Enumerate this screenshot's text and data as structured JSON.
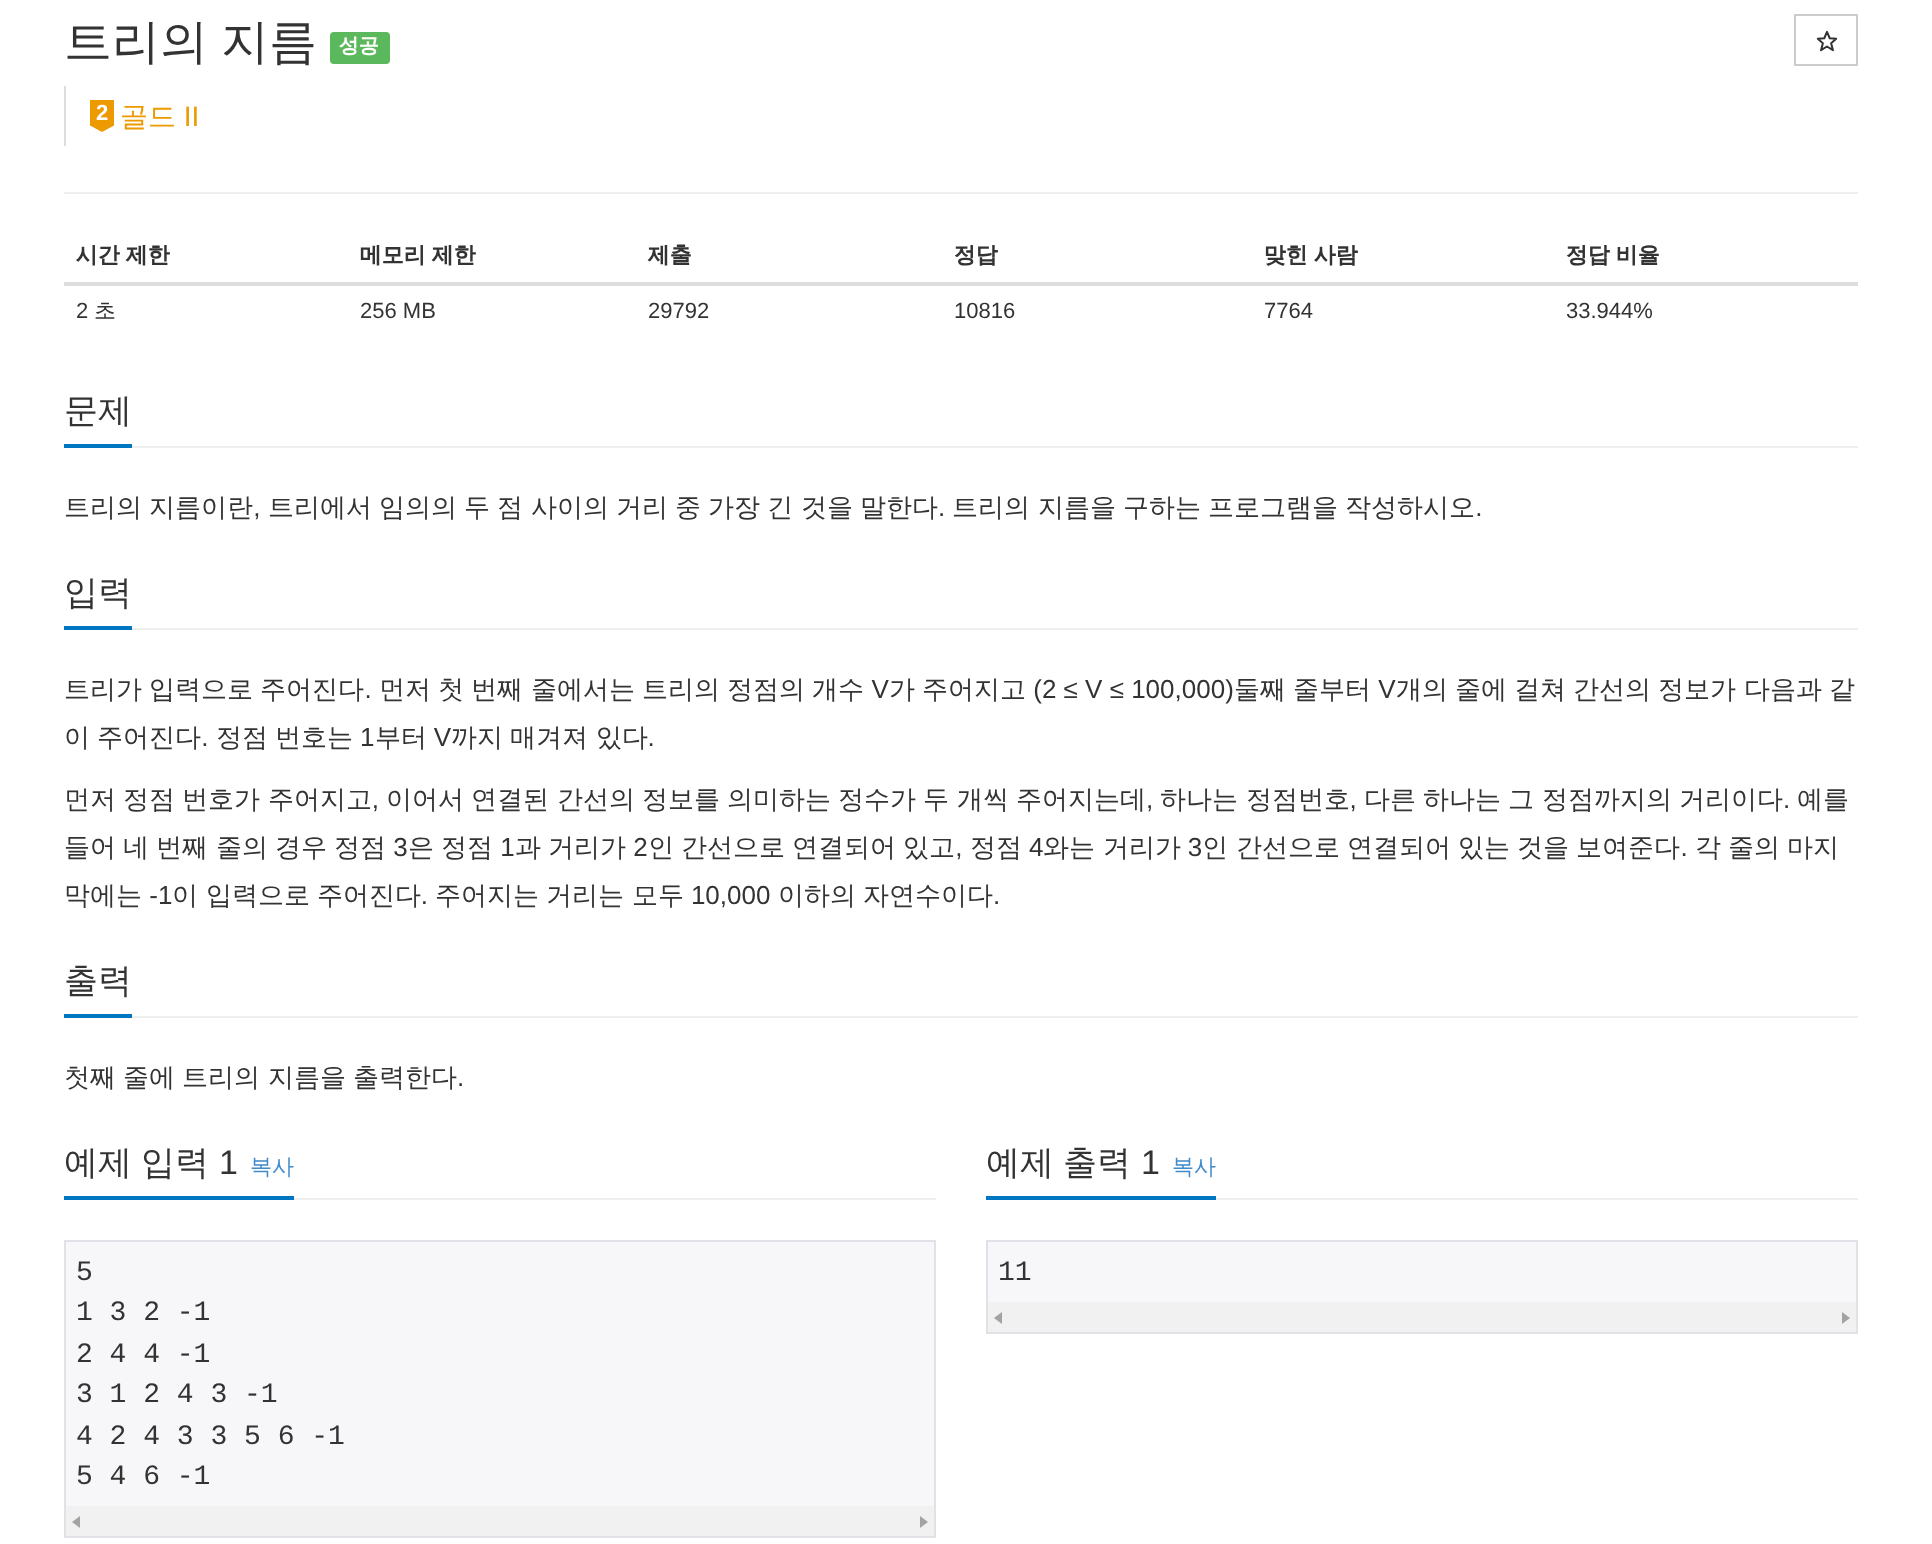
{
  "problem": {
    "title": "트리의 지름",
    "result_badge": "성공",
    "starred": false,
    "tier": {
      "number": "2",
      "name": "골드 II"
    }
  },
  "stats_table": {
    "columns": [
      "시간 제한",
      "메모리 제한",
      "제출",
      "정답",
      "맞힌 사람",
      "정답 비율"
    ],
    "rows": [
      [
        "2 초",
        "256 MB",
        "29792",
        "10816",
        "7764",
        "33.944%"
      ]
    ]
  },
  "sections": [
    {
      "heading": "문제",
      "paragraphs": [
        "트리의 지름이란, 트리에서 임의의 두 점 사이의 거리 중 가장 긴 것을 말한다. 트리의 지름을 구하는 프로그램을 작성하시오."
      ]
    },
    {
      "heading": "입력",
      "paragraphs": [
        "트리가 입력으로 주어진다. 먼저 첫 번째 줄에서는 트리의 정점의 개수 V가 주어지고 (2 ≤ V ≤ 100,000)둘째 줄부터 V개의 줄에 걸쳐 간선의 정보가 다음과 같이 주어진다. 정점 번호는 1부터 V까지 매겨져 있다.",
        "먼저 정점 번호가 주어지고, 이어서 연결된 간선의 정보를 의미하는 정수가 두 개씩 주어지는데, 하나는 정점번호, 다른 하나는 그 정점까지의 거리이다. 예를 들어 네 번째 줄의 경우 정점 3은 정점 1과 거리가 2인 간선으로 연결되어 있고, 정점 4와는 거리가 3인 간선으로 연결되어 있는 것을 보여준다. 각 줄의 마지막에는 -1이 입력으로 주어진다. 주어지는 거리는 모두 10,000 이하의 자연수이다."
      ]
    },
    {
      "heading": "출력",
      "paragraphs": [
        "첫째 줄에 트리의 지름을 출력한다."
      ]
    }
  ],
  "samples": [
    {
      "heading": "예제 입력 1",
      "copy_label": "복사",
      "lines": [
        "5",
        "1 3 2 -1",
        "2 4 4 -1",
        "3 1 2 4 3 -1",
        "4 2 4 3 3 5 6 -1",
        "5 4 6 -1"
      ]
    },
    {
      "heading": "예제 출력 1",
      "copy_label": "복사",
      "lines": [
        "11"
      ]
    }
  ]
}
